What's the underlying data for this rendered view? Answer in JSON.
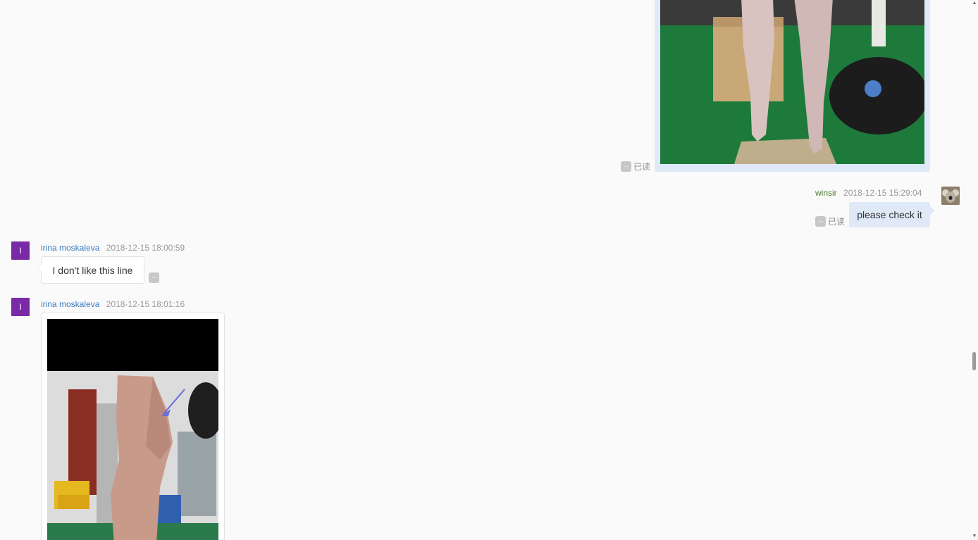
{
  "outgoing_image": {
    "read_label": "已读",
    "more_icon": "more-dots-icon",
    "image_description_icon": "photo"
  },
  "outgoing_text": {
    "sender": "winsir",
    "timestamp": "2018-12-15 15:29:04",
    "text": "please check it",
    "read_label": "已读"
  },
  "incoming_text": {
    "avatar_letter": "I",
    "sender": "irina moskaleva",
    "timestamp": "2018-12-15 18:00:59",
    "text": "I don't like this line",
    "more_icon": "more-dots-icon"
  },
  "incoming_image": {
    "avatar_letter": "I",
    "sender": "irina moskaleva",
    "timestamp": "2018-12-15 18:01:16"
  },
  "colors": {
    "background": "#fafafa",
    "outgoing_bubble": "#dfe9f8",
    "incoming_avatar": "#7a2aa6",
    "outgoing_sender": "#4a7b2f",
    "incoming_sender": "#3b7bbf"
  },
  "scrollbar": {
    "up_icon": "scroll-up-arrow-icon",
    "down_icon": "scroll-down-arrow-icon"
  }
}
